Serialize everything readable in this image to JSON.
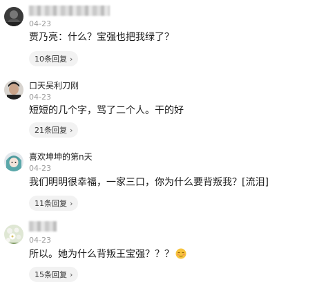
{
  "comments": [
    {
      "username": "",
      "username_blurred": true,
      "date": "04-23",
      "text": "贾乃亮：什么？宝强也把我绿了？",
      "reply_label": "10条回复",
      "avatar_icon": "person-dark-avatar"
    },
    {
      "username": "口天吴利刀刚",
      "username_blurred": false,
      "date": "04-23",
      "text": "短短的几个字，骂了二个人。干的好",
      "reply_label": "21条回复",
      "avatar_icon": "person-portrait-avatar"
    },
    {
      "username": "喜欢坤坤的第n天",
      "username_blurred": false,
      "date": "04-23",
      "text": "我们明明很幸福，一家三口，你为什么要背叛我？[流泪]",
      "reply_label": "11条回复",
      "avatar_icon": "anime-girl-avatar"
    },
    {
      "username": "",
      "username_blurred": true,
      "date": "04-23",
      "text": "所以。她为什么背叛王宝强？？？",
      "reply_label": "15条回复",
      "avatar_icon": "flowers-avatar",
      "trailing_emoji": "embarrassed-face-emoji"
    }
  ],
  "colors": {
    "date": "#9a9a9a",
    "pill_bg": "#f2f2f2",
    "text": "#1a1a1a"
  }
}
